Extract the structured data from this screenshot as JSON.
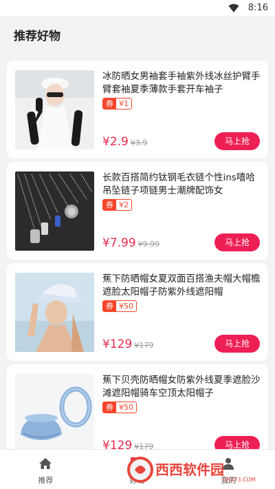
{
  "status_bar": {
    "time": "8:16",
    "icon": "wifi-icon"
  },
  "header": {
    "title": "推荐好物"
  },
  "products": [
    {
      "title": "冰防晒女男袖套手袖紫外线冰丝护臂手臂套袖夏季薄款手套开车袖子",
      "coupon_label": "券",
      "coupon_value": "¥1",
      "price": "¥2.9",
      "original_price": "¥3.9",
      "buy_label": "马上抢"
    },
    {
      "title": "长款百搭简约钛钢毛衣链个性ins嘻哈吊坠链子项链男士潮牌配饰女",
      "coupon_label": "券",
      "coupon_value": "¥2",
      "price": "¥7.99",
      "original_price": "¥9.99",
      "buy_label": "马上抢"
    },
    {
      "title": "蕉下防晒帽女夏双面百搭渔夫帽大帽檐遮脸太阳帽子防紫外线遮阳帽",
      "coupon_label": "券",
      "coupon_value": "¥50",
      "price": "¥129",
      "original_price": "¥179",
      "buy_label": "马上抢"
    },
    {
      "title": "蕉下贝壳防晒帽女防紫外线夏季遮脸沙滩遮阳帽骑车空顶太阳帽子",
      "coupon_label": "券",
      "coupon_value": "¥50",
      "price": "¥129",
      "original_price": "¥179",
      "buy_label": "马上抢"
    }
  ],
  "tab_bar": {
    "tabs": [
      {
        "label": "推荐",
        "icon": "home-icon"
      },
      {
        "label": "好物",
        "icon": "grid-icon"
      },
      {
        "label": "我的",
        "icon": "user-icon"
      }
    ]
  },
  "watermark": {
    "text": "西西软件园",
    "sub": "CR173.COM"
  },
  "colors": {
    "accent": "#ee1f55",
    "price": "#e8284c",
    "coupon": "#f5442b",
    "background": "#f3f3f3"
  }
}
